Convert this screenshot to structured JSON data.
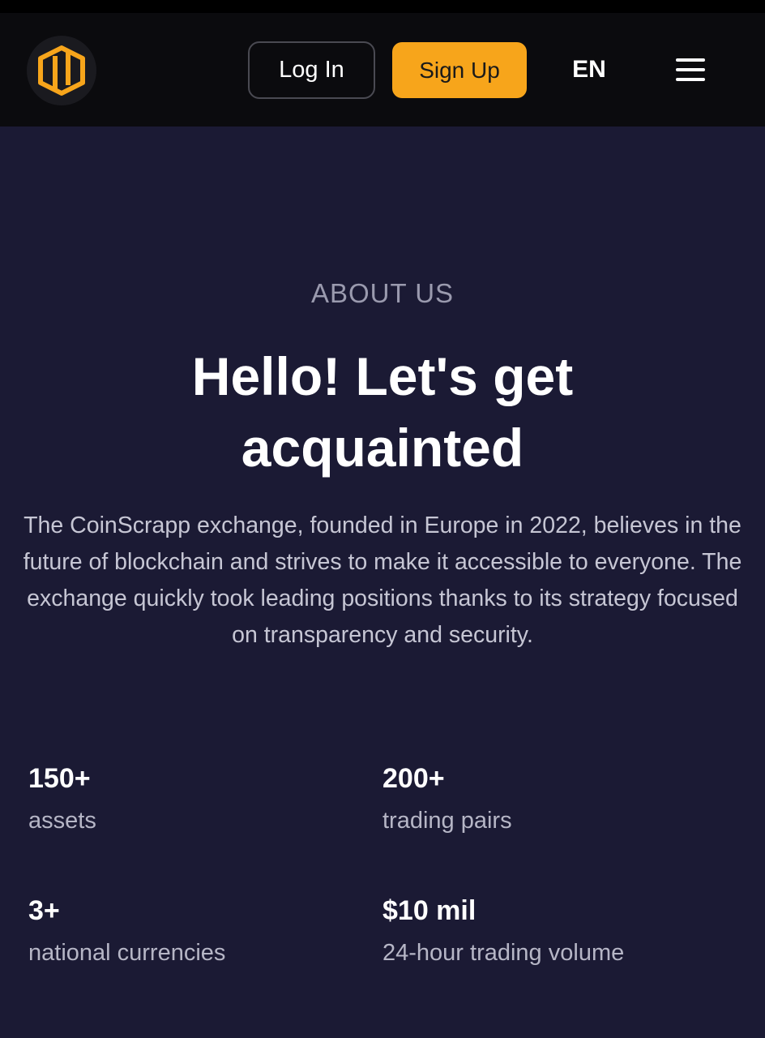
{
  "header": {
    "logo_icon": "coinscrapp-logo-icon",
    "login_label": "Log In",
    "signup_label": "Sign Up",
    "language": "EN",
    "menu_icon": "hamburger-menu-icon"
  },
  "about": {
    "eyebrow": "ABOUT US",
    "title": "Hello! Let's get acquainted",
    "description": "The CoinScrapp exchange, founded in Europe in 2022, believes in the future of blockchain and strives to make it accessible to everyone. The exchange quickly took leading positions thanks to its strategy focused on transparency and security."
  },
  "stats": [
    {
      "value": "150+",
      "label": "assets"
    },
    {
      "value": "200+",
      "label": "trading pairs"
    },
    {
      "value": "3+",
      "label": "national currencies"
    },
    {
      "value": "$10 mil",
      "label": "24-hour trading volume"
    }
  ],
  "colors": {
    "accent": "#f7a51b",
    "background": "#1b1a34",
    "header": "#0b0b0e"
  }
}
